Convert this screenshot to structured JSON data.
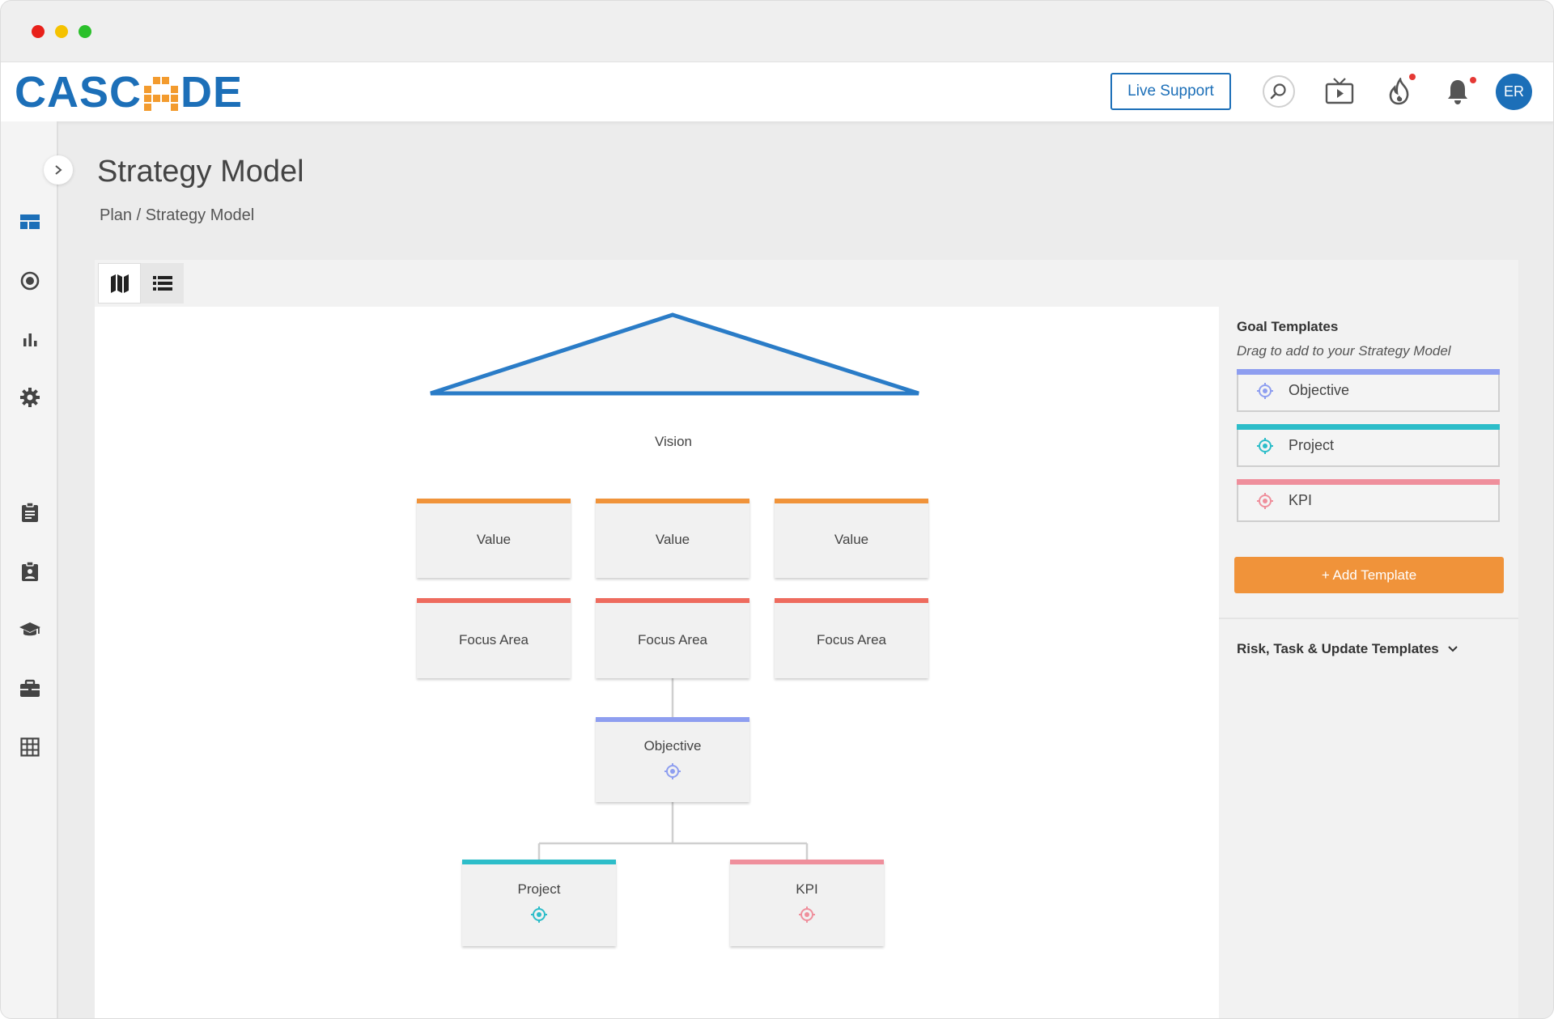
{
  "window": {
    "controls": [
      "close",
      "minimize",
      "maximize"
    ]
  },
  "brand": {
    "logo_text_left": "CASC",
    "logo_text_right": "DE",
    "color": "#1c6fb8",
    "accent": "#f39b2e"
  },
  "topbar": {
    "live_support_label": "Live Support",
    "icons": [
      "search-icon",
      "tv-icon",
      "fire-icon",
      "bell-icon"
    ],
    "avatar_initials": "ER"
  },
  "sidebar": {
    "items": [
      "dashboard-icon",
      "target-icon",
      "chart-icon",
      "settings-icon",
      "clipboard-icon",
      "assignment-icon",
      "graduation-icon",
      "briefcase-icon",
      "grid-icon"
    ]
  },
  "page": {
    "title": "Strategy Model",
    "breadcrumb": "Plan / Strategy Model"
  },
  "view_toggle": [
    "map-view",
    "list-view"
  ],
  "model": {
    "vision": "Vision",
    "values": [
      "Value",
      "Value",
      "Value"
    ],
    "focus_areas": [
      "Focus Area",
      "Focus Area",
      "Focus Area"
    ],
    "objective": "Objective",
    "project": "Project",
    "kpi": "KPI"
  },
  "colors": {
    "vision": "#2a7cc7",
    "value": "#f0933a",
    "focus": "#ee6b5e",
    "objective": "#8e9ef0",
    "project": "#2dbdc9",
    "kpi": "#ef8f9c"
  },
  "goal_templates": {
    "title": "Goal Templates",
    "subtitle": "Drag to add to your Strategy Model",
    "items": [
      {
        "label": "Objective",
        "color": "#8e9ef0"
      },
      {
        "label": "Project",
        "color": "#2dbdc9"
      },
      {
        "label": "KPI",
        "color": "#ef8f9c"
      }
    ],
    "add_label": "+ Add Template"
  },
  "other_templates": {
    "label": "Risk, Task & Update Templates"
  }
}
